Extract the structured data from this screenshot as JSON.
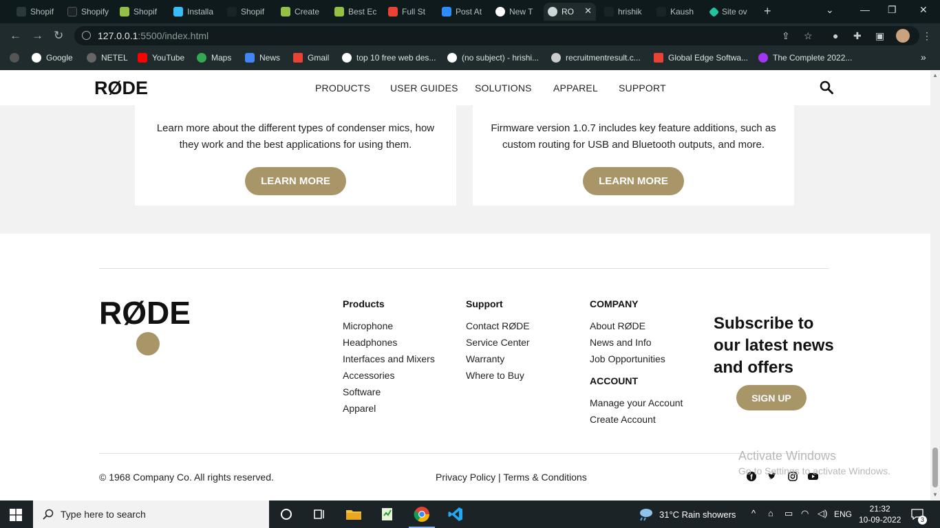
{
  "browser": {
    "tabs": [
      {
        "label": "Shopif"
      },
      {
        "label": "Shopify"
      },
      {
        "label": "Shopif"
      },
      {
        "label": "Installa"
      },
      {
        "label": "Shopif"
      },
      {
        "label": "Create"
      },
      {
        "label": "Best Ec"
      },
      {
        "label": "Full St"
      },
      {
        "label": "Post At"
      },
      {
        "label": "New T"
      },
      {
        "label": "RO"
      },
      {
        "label": "hrishik"
      },
      {
        "label": "Kaush"
      },
      {
        "label": "Site ov"
      }
    ],
    "active_tab_close": "✕",
    "new_tab": "+",
    "url_host": "127.0.0.1",
    "url_rest": ":5500/index.html",
    "bookmarks": [
      {
        "label": "Google"
      },
      {
        "label": "NETEL"
      },
      {
        "label": "YouTube"
      },
      {
        "label": "Maps"
      },
      {
        "label": "News"
      },
      {
        "label": "Gmail"
      },
      {
        "label": "top 10 free web des..."
      },
      {
        "label": "(no subject) - hrishi..."
      },
      {
        "label": "recruitmentresult.c..."
      },
      {
        "label": "Global Edge Softwa..."
      },
      {
        "label": "The Complete 2022..."
      }
    ],
    "bookmarks_more": "»"
  },
  "site": {
    "logo": "RØDE",
    "nav": {
      "products": "PRODUCTS",
      "user_guides": "USER GUIDES",
      "solutions": "SOLUTIONS",
      "apparel": "APPAREL",
      "support": "SUPPORT"
    },
    "cards": [
      {
        "text": "Learn more about the different types of condenser mics, how they work and the best applications for using them.",
        "button": "LEARN MORE"
      },
      {
        "text": "Firmware version 1.0.7 includes key feature additions, such as custom routing for USB and Bluetooth outputs, and more.",
        "button": "LEARN MORE"
      }
    ],
    "accent_color": "#a89568"
  },
  "footer": {
    "logo": "RØDE",
    "products_title": "Products",
    "products": [
      "Microphone",
      "Headphones",
      "Interfaces and Mixers",
      "Accessories",
      "Software",
      "Apparel"
    ],
    "support_title": "Support",
    "support": [
      "Contact RØDE",
      "Service Center",
      "Warranty",
      "Where to Buy"
    ],
    "company_title": "COMPANY",
    "company": [
      "About RØDE",
      "News and Info",
      "Job Opportunities"
    ],
    "account_title": "ACCOUNT",
    "account": [
      "Manage your Account",
      "Create Account"
    ],
    "subscribe": "Subscribe to our latest news and offers",
    "signup": "SIGN UP",
    "copyright": "© 1968 Company Co. All rights reserved.",
    "privacy": "Privacy Policy",
    "separator": "|",
    "terms": "Terms & Conditions",
    "social_icons": [
      "facebook-icon",
      "twitter-icon",
      "instagram-icon",
      "youtube-icon"
    ]
  },
  "watermark": {
    "line1": "Activate Windows",
    "line2": "Go to Settings to activate Windows."
  },
  "taskbar": {
    "search_placeholder": "Type here to search",
    "weather": "31°C  Rain showers",
    "lang": "ENG",
    "time": "21:32",
    "date": "10-09-2022",
    "notification_count": "3"
  }
}
